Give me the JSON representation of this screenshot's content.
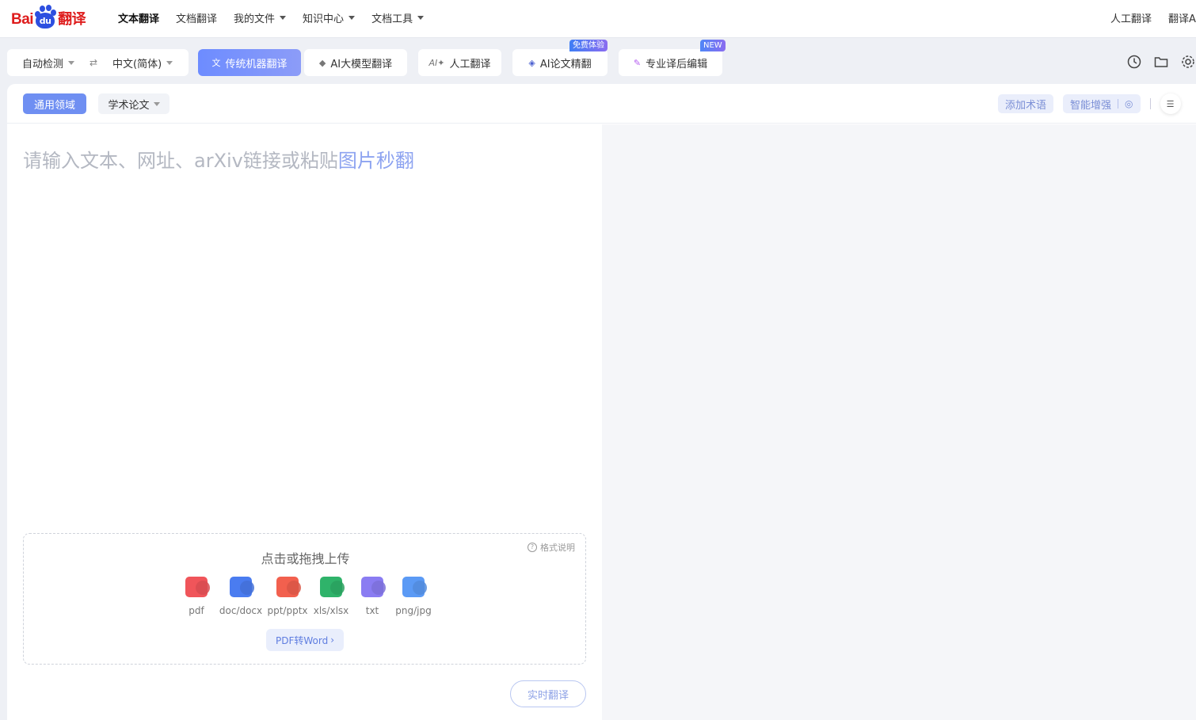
{
  "header": {
    "logo": {
      "bai": "Bai",
      "du": "du",
      "fanyi": "翻译"
    },
    "nav": [
      {
        "label": "文本翻译",
        "active": true,
        "dropdown": false
      },
      {
        "label": "文档翻译",
        "active": false,
        "dropdown": false
      },
      {
        "label": "我的文件",
        "active": false,
        "dropdown": true
      },
      {
        "label": "知识中心",
        "active": false,
        "dropdown": true
      },
      {
        "label": "文档工具",
        "active": false,
        "dropdown": true
      }
    ],
    "right": [
      "人工翻译",
      "翻译A"
    ]
  },
  "toolbar": {
    "source_lang": "自动检测",
    "swap_icon": "swap-icon",
    "target_lang": "中文(简体)",
    "modes": [
      {
        "label": "传统机器翻译",
        "icon": "translate-icon",
        "active": true
      },
      {
        "label": "AI大模型翻译",
        "icon": "cube-icon",
        "active": false
      },
      {
        "label": "人工翻译",
        "icon": "ai-sparkle-icon",
        "active": false
      },
      {
        "label": "AI论文精翻",
        "icon": "layers-icon",
        "active": false,
        "badge": "免费体验"
      },
      {
        "label": "专业译后编辑",
        "icon": "pen-icon",
        "active": false,
        "badge": "NEW"
      }
    ],
    "right_icons": [
      "history-icon",
      "folder-icon",
      "settings-icon"
    ]
  },
  "panel": {
    "domains": [
      {
        "label": "通用领域",
        "active": true
      },
      {
        "label": "学术论文",
        "active": false
      }
    ],
    "add_term": "添加术语",
    "smart_enhance": "智能增强",
    "input": {
      "placeholder_main": "请输入文本、网址、arXiv链接或粘贴",
      "placeholder_highlight": "图片秒翻"
    },
    "upload": {
      "title": "点击或拖拽上传",
      "format_help": "格式说明",
      "file_types": [
        {
          "label": "pdf",
          "icon": "pdf-file-icon",
          "color": "#f0555a"
        },
        {
          "label": "doc/docx",
          "icon": "word-file-icon",
          "color": "#4a7cf0"
        },
        {
          "label": "ppt/pptx",
          "icon": "ppt-file-icon",
          "color": "#f2604e"
        },
        {
          "label": "xls/xlsx",
          "icon": "excel-file-icon",
          "color": "#2fb36a"
        },
        {
          "label": "txt",
          "icon": "txt-file-icon",
          "color": "#8a7cf2"
        },
        {
          "label": "png/jpg",
          "icon": "image-file-icon",
          "color": "#5b9af5"
        }
      ],
      "pdf_to_word": "PDF转Word"
    },
    "realtime_translate": "实时翻译"
  },
  "colors": {
    "accent": "#6f8ff2",
    "brand_red": "#de1c1c",
    "brand_blue": "#2d4fe0",
    "badge_free": "#5a7df5",
    "badge_new": "#4f86f7"
  }
}
